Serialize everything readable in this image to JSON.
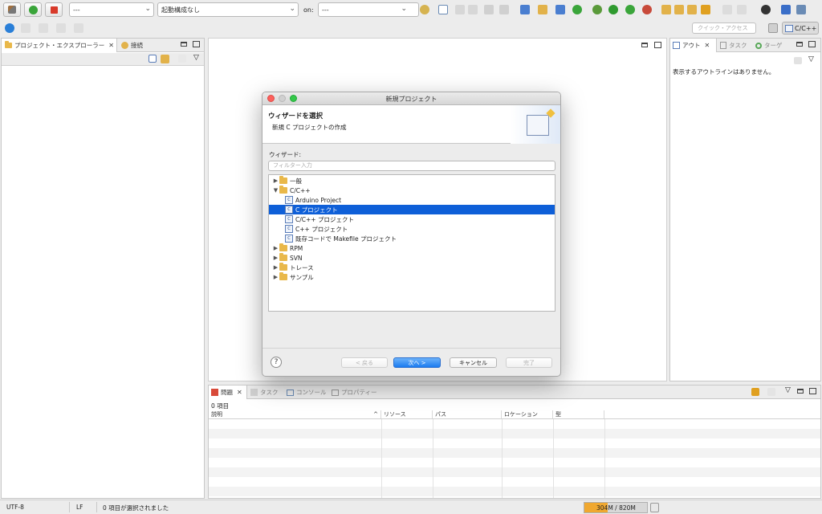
{
  "toolbar": {
    "launch_mode": "---",
    "launch_config": "起動構成なし",
    "on_label": "on:",
    "launch_target": "---",
    "quick_access_placeholder": "クイック・アクセス",
    "perspective_label": "C/C++"
  },
  "left_panel": {
    "tabs": [
      {
        "label": "プロジェクト・エクスプローラー"
      },
      {
        "label": "接続"
      }
    ]
  },
  "right_panel": {
    "tabs": [
      {
        "label": "アウト"
      },
      {
        "label": "タスク"
      },
      {
        "label": "ターゲ"
      }
    ],
    "empty_message": "表示するアウトラインはありません。"
  },
  "bottom_panel": {
    "tabs": [
      {
        "label": "問題"
      },
      {
        "label": "タスク"
      },
      {
        "label": "コンソール"
      },
      {
        "label": "プロパティー"
      }
    ],
    "item_count": "0 項目",
    "columns": [
      "説明",
      "リソース",
      "パス",
      "ロケーション",
      "型"
    ]
  },
  "dialog": {
    "window_title": "新規プロジェクト",
    "header_title": "ウィザードを選択",
    "header_subtitle": "新規 C プロジェクトの作成",
    "wizards_label": "ウィザード:",
    "filter_placeholder": "フィルター入力",
    "tree": [
      {
        "label": "一般",
        "type": "folder",
        "expanded": false,
        "level": 0
      },
      {
        "label": "C/C++",
        "type": "folder",
        "expanded": true,
        "level": 0
      },
      {
        "label": "Arduino Project",
        "type": "project",
        "level": 1
      },
      {
        "label": "C プロジェクト",
        "type": "project",
        "level": 1,
        "selected": true
      },
      {
        "label": "C/C++ プロジェクト",
        "type": "project",
        "level": 1
      },
      {
        "label": "C++ プロジェクト",
        "type": "project",
        "level": 1
      },
      {
        "label": "既存コードで Makefile プロジェクト",
        "type": "project",
        "level": 1
      },
      {
        "label": "RPM",
        "type": "folder",
        "expanded": false,
        "level": 0
      },
      {
        "label": "SVN",
        "type": "folder",
        "expanded": false,
        "level": 0
      },
      {
        "label": "トレース",
        "type": "folder",
        "expanded": false,
        "level": 0
      },
      {
        "label": "サンプル",
        "type": "folder",
        "expanded": false,
        "level": 0
      }
    ],
    "help_label": "?",
    "back_label": "< 戻る",
    "next_label": "次へ >",
    "cancel_label": "キャンセル",
    "finish_label": "完了"
  },
  "statusbar": {
    "encoding": "UTF-8",
    "line_ending": "LF",
    "selection": "0 項目が選択されました",
    "memory": "304M / 820M",
    "memory_used_fraction": 0.37
  }
}
